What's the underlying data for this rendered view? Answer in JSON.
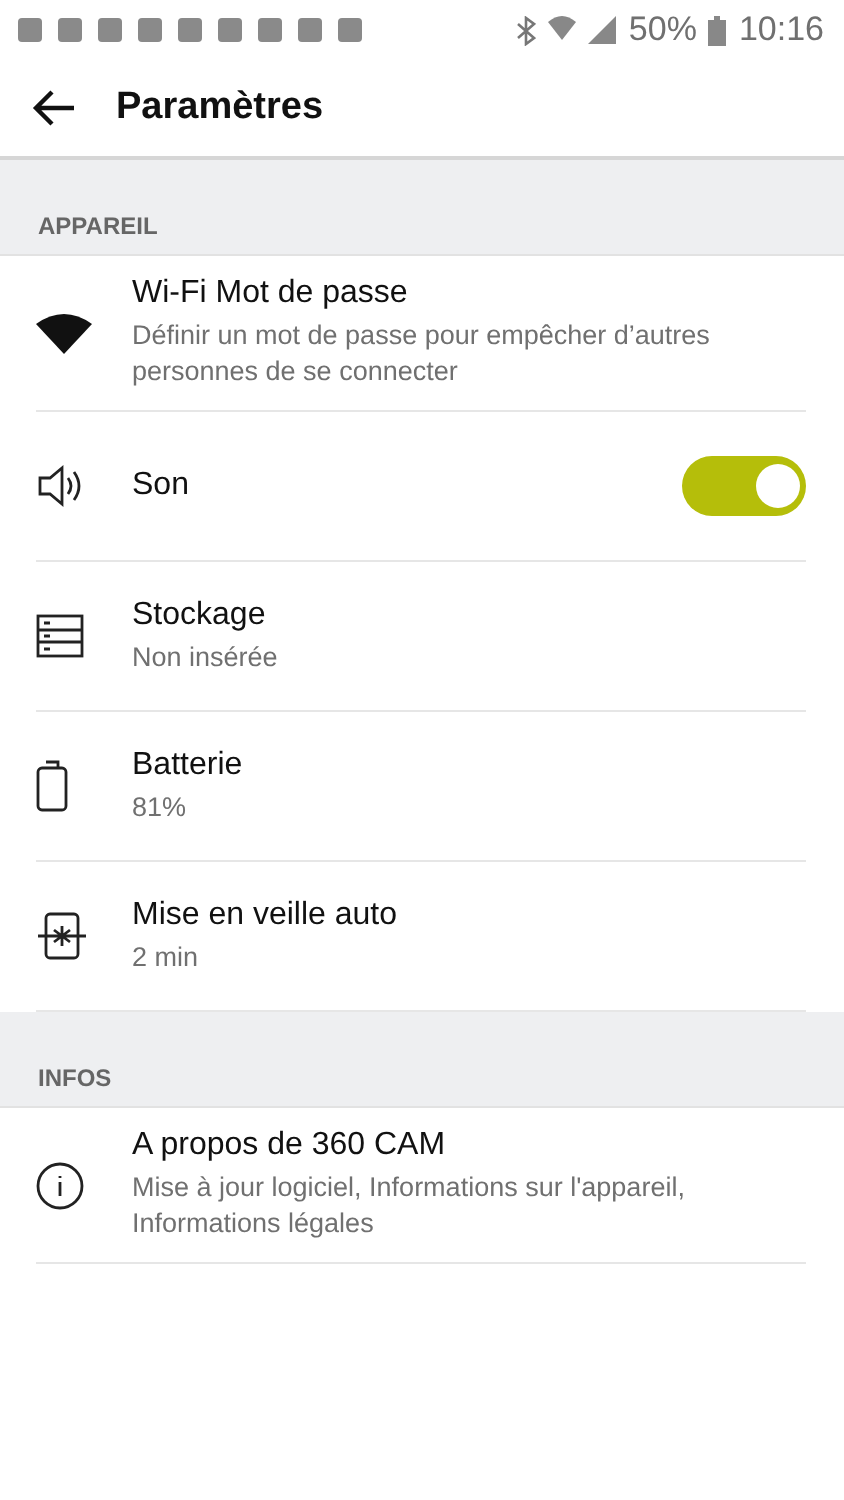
{
  "status_bar": {
    "battery_percent": "50%",
    "time": "10:16"
  },
  "header": {
    "title": "Paramètres"
  },
  "sections": [
    {
      "title": "APPAREIL",
      "items": [
        {
          "kind": "text",
          "title": "Wi-Fi Mot de passe",
          "subtitle": "Définir un mot de passe pour empêcher d’autres personnes de se connecter"
        },
        {
          "kind": "toggle",
          "title": "Son",
          "on": true
        },
        {
          "kind": "text",
          "title": "Stockage",
          "subtitle": "Non insérée"
        },
        {
          "kind": "text",
          "title": "Batterie",
          "subtitle": "81%"
        },
        {
          "kind": "text",
          "title": "Mise en veille auto",
          "subtitle": "2 min"
        }
      ]
    },
    {
      "title": "INFOS",
      "items": [
        {
          "kind": "text",
          "title": "A propos de 360 CAM",
          "subtitle": "Mise à jour logiciel, Informations sur l'appareil, Informations légales"
        }
      ]
    }
  ]
}
